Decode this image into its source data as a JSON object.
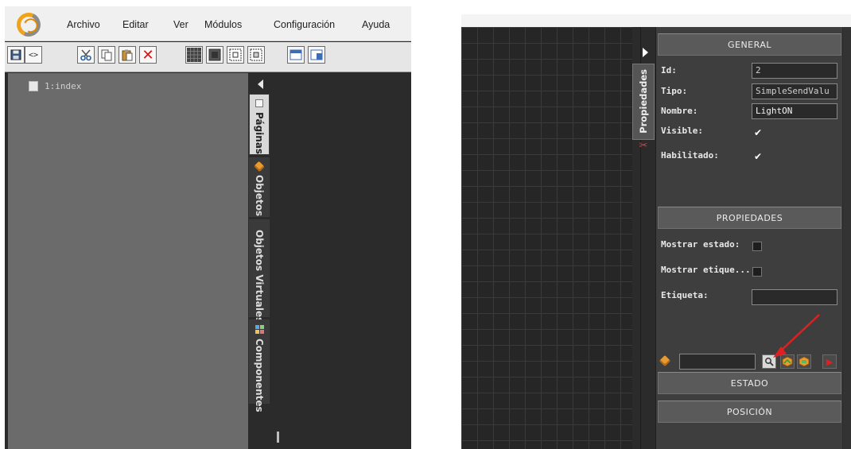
{
  "left_window": {
    "menu": [
      "Archivo",
      "Editar",
      "Ver",
      "Módulos",
      "Configuración",
      "Ayuda"
    ],
    "toolbar_icons": [
      "save-icon",
      "code-icon",
      "cut-icon",
      "copy-icon",
      "paste-icon",
      "delete-icon",
      "grid-icon",
      "fill-icon",
      "border-icon-1",
      "border-icon-2",
      "window-icon-1",
      "window-icon-2"
    ],
    "pages": [
      {
        "label": "1:index"
      }
    ],
    "side_tabs": [
      {
        "label": "Páginas",
        "icon": "page-icon",
        "active": true
      },
      {
        "label": "Objetos",
        "icon": "cube-icon",
        "active": false
      },
      {
        "label": "Objetos Virtuales",
        "icon": "cube-icon",
        "active": false
      },
      {
        "label": "Componentes",
        "icon": "components-icon",
        "active": false
      }
    ]
  },
  "right_window": {
    "side_tab": {
      "label": "Propiedades",
      "icon": "tools-icon"
    },
    "sections": {
      "general": "GENERAL",
      "properties": "PROPIEDADES",
      "state": "ESTADO",
      "position": "POSICIÓN"
    },
    "general_fields": {
      "id_label": "Id:",
      "id_value": "2",
      "type_label": "Tipo:",
      "type_value": "SimpleSendValu",
      "name_label": "Nombre:",
      "name_value": "LightON",
      "visible_label": "Visible:",
      "visible_checked": true,
      "enabled_label": "Habilitado:",
      "enabled_checked": true
    },
    "property_fields": {
      "show_state_label": "Mostrar estado:",
      "show_state_checked": false,
      "show_label_label": "Mostrar etique...",
      "show_label_checked": false,
      "label_label": "Etiqueta:",
      "label_value": ""
    },
    "object_row": {
      "object_value": "",
      "buttons": [
        "search-icon",
        "object-add-icon",
        "object-link-icon",
        "remove-icon"
      ]
    },
    "colors": {
      "panel_bg": "#3e3e3e",
      "header_bg": "#5a5a5a",
      "accent_orange": "#e99b2f",
      "arrow_red": "#e02020"
    }
  }
}
